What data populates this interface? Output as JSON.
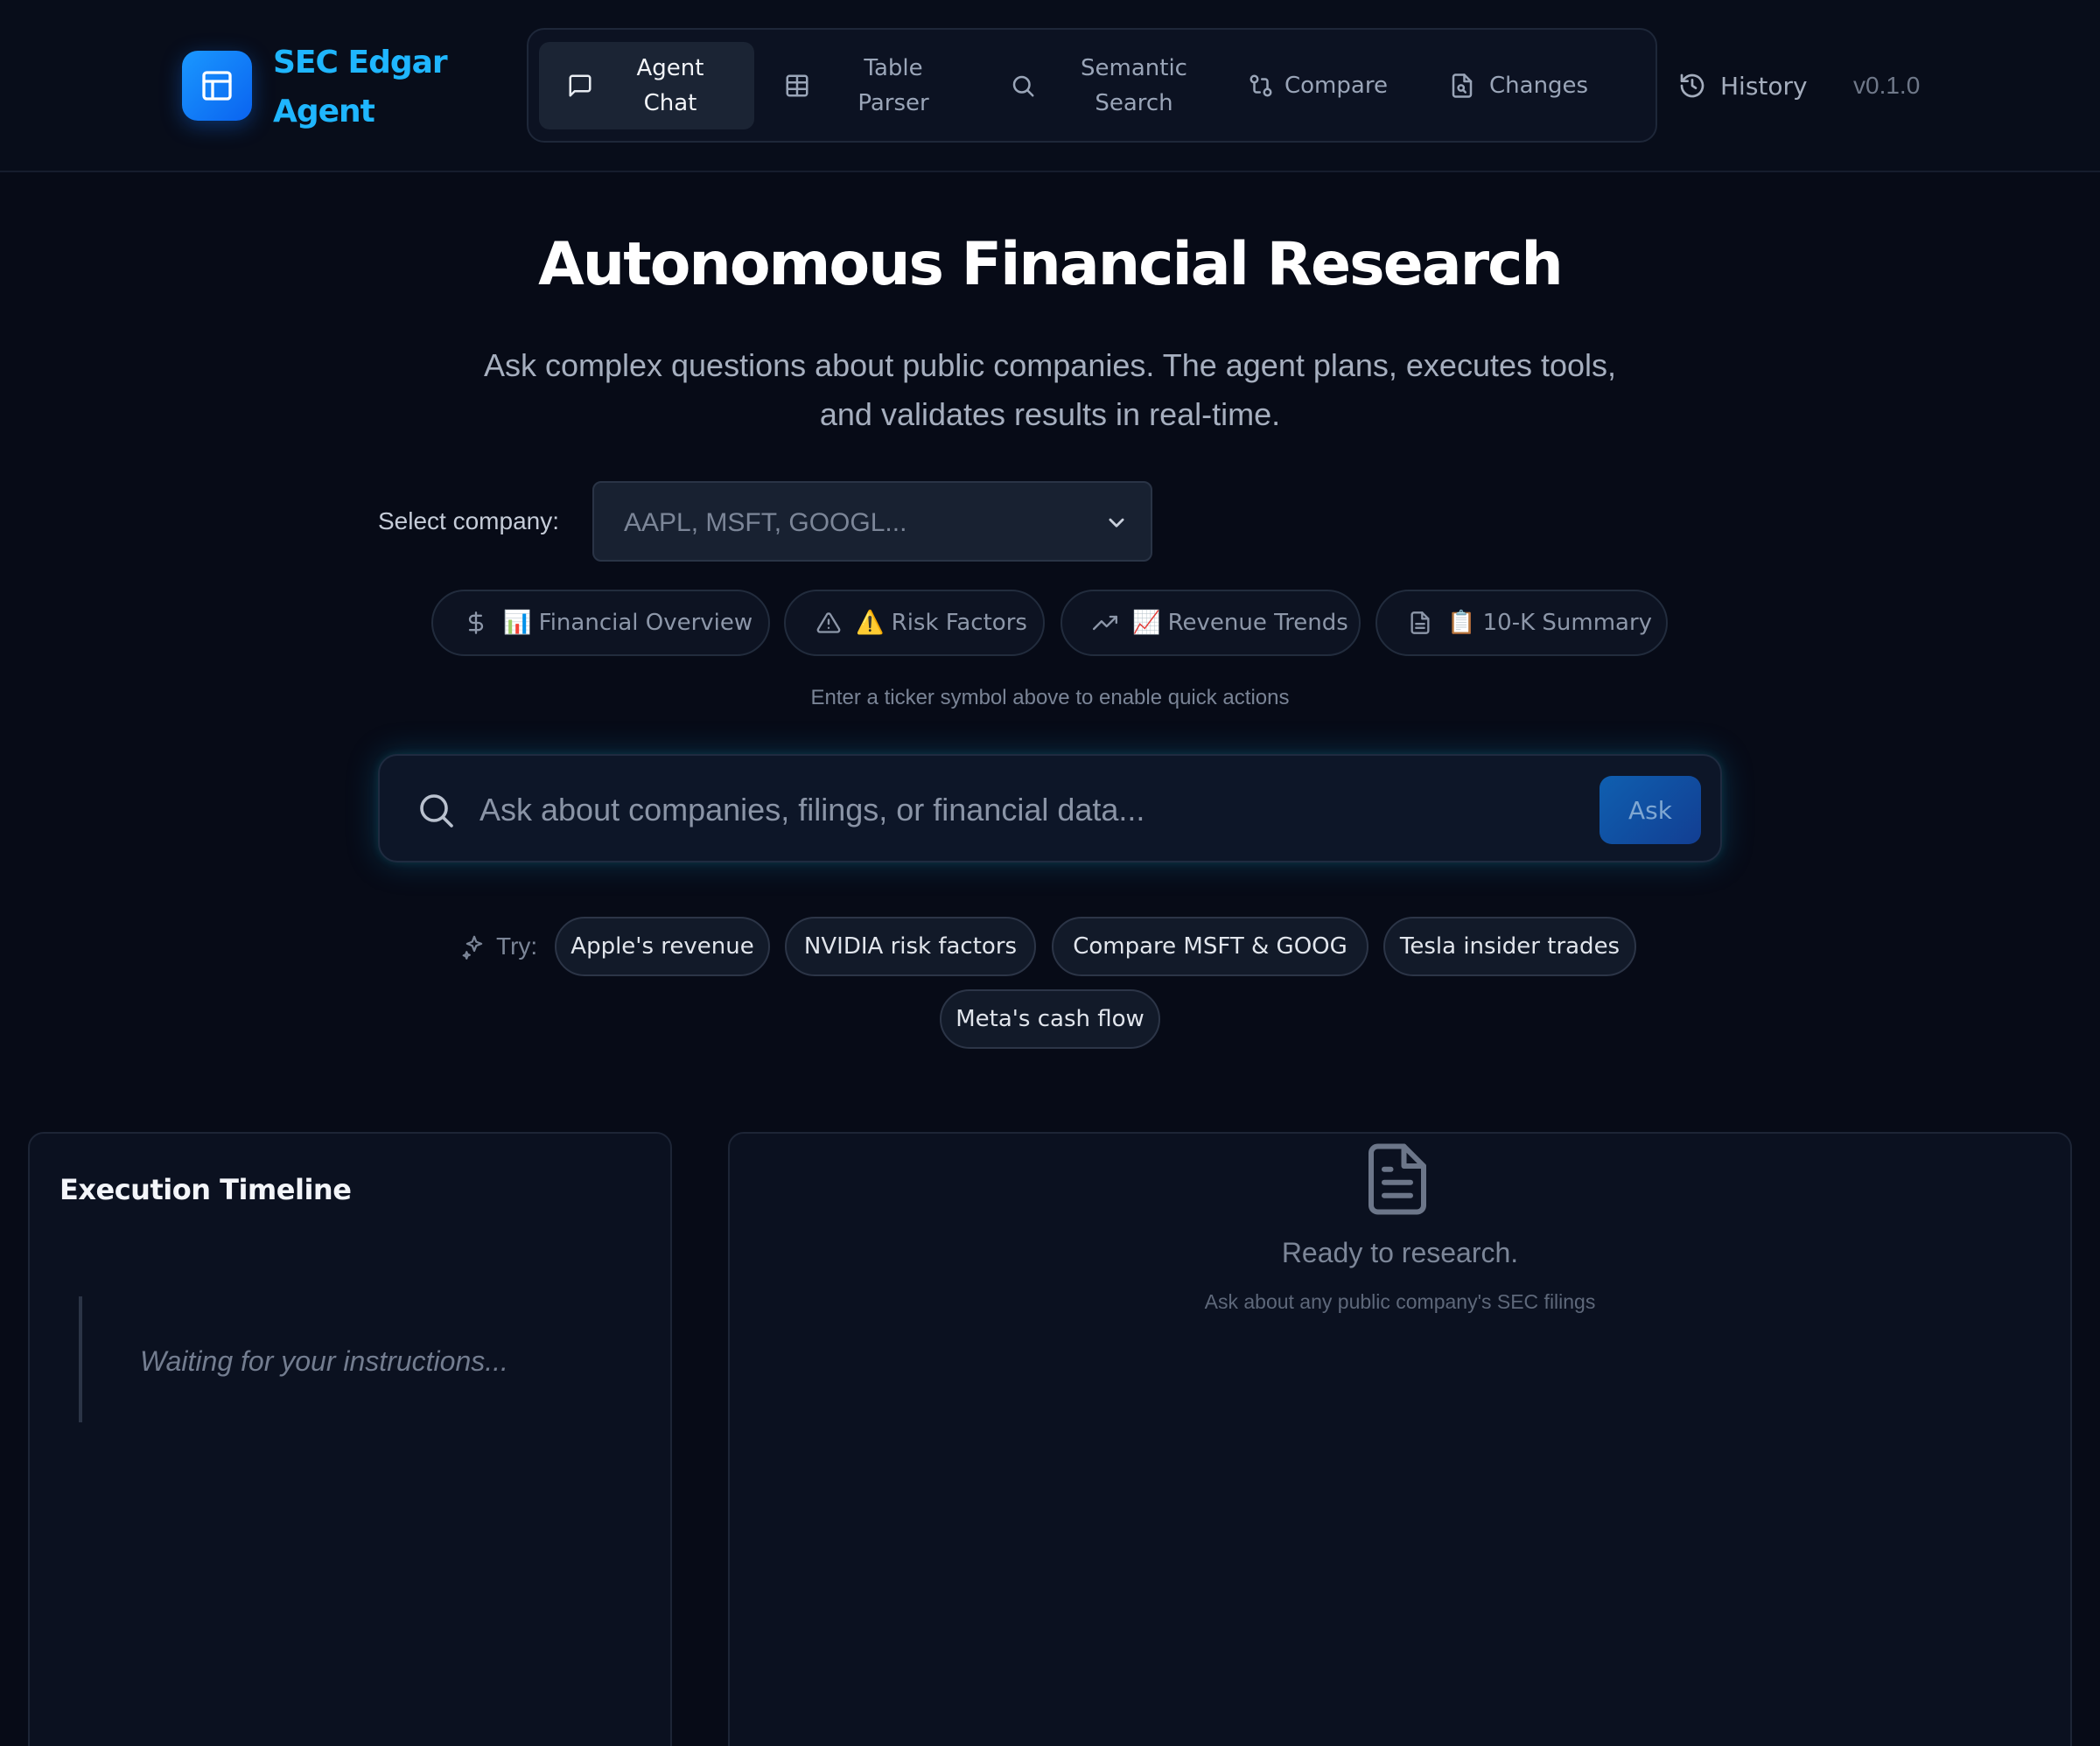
{
  "brand": {
    "name": "SEC Edgar Agent",
    "accent": "#1fb6ff"
  },
  "nav": {
    "tabs": [
      {
        "label": "Agent Chat",
        "icon": "message-square-icon",
        "active": true
      },
      {
        "label": "Table Parser",
        "icon": "table-icon"
      },
      {
        "label": "Semantic Search",
        "icon": "search-icon"
      },
      {
        "label": "Compare",
        "icon": "git-compare-icon"
      },
      {
        "label": "Changes",
        "icon": "file-diff-icon"
      }
    ],
    "history_label": "History",
    "version": "v0.1.0"
  },
  "hero": {
    "title": "Autonomous Financial Research",
    "subtitle": "Ask complex questions about public companies. The agent plans, executes tools, and validates results in real-time."
  },
  "company_select": {
    "label": "Select company:",
    "placeholder": "AAPL, MSFT, GOOGL..."
  },
  "quick_actions": [
    {
      "label": "📊 Financial Overview",
      "icon": "dollar-icon"
    },
    {
      "label": "⚠️ Risk Factors",
      "icon": "alert-triangle-icon"
    },
    {
      "label": "📈 Revenue Trends",
      "icon": "trending-up-icon"
    },
    {
      "label": "📋 10-K Summary",
      "icon": "file-text-icon"
    }
  ],
  "quick_actions_hint": "Enter a ticker symbol above to enable quick actions",
  "search": {
    "placeholder": "Ask about companies, filings, or financial data...",
    "button_label": "Ask"
  },
  "suggestions": {
    "label": "Try:",
    "items": [
      "Apple's revenue",
      "NVIDIA risk factors",
      "Compare MSFT & GOOG",
      "Tesla insider trades",
      "Meta's cash flow"
    ]
  },
  "timeline": {
    "title": "Execution Timeline",
    "empty_text": "Waiting for your instructions..."
  },
  "results": {
    "empty_title": "Ready to research.",
    "empty_subtitle": "Ask about any public company's SEC filings"
  }
}
